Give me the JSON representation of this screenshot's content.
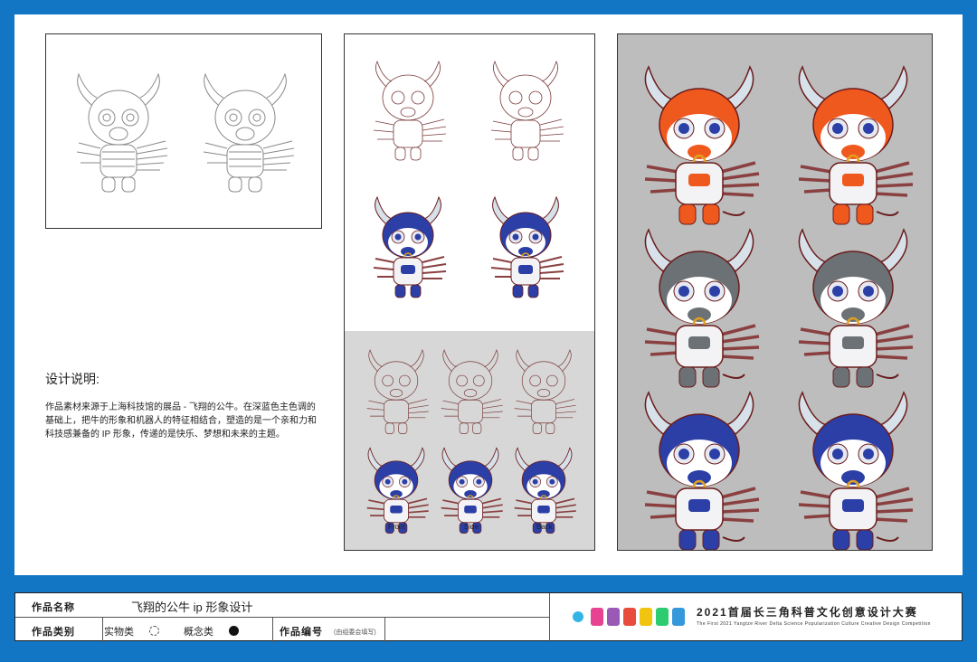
{
  "description": {
    "title": "设计说明:",
    "body": "作品素材来源于上海科技馆的展品 - 飞翔的公牛。在深蓝色主色调的基础上，把牛的形象和机器人的特征相结合，塑造的是一个亲和力和科技感兼备的 IP 形象，传递的是快乐、梦想和未来的主题。"
  },
  "views": {
    "front": "Front",
    "side": "Side",
    "back": "Back"
  },
  "footer": {
    "name_label": "作品名称",
    "name_value": "飞翔的公牛 ip 形象设计",
    "category_label": "作品类别",
    "option_physical": "实物类",
    "option_concept": "概念类",
    "number_label": "作品编号",
    "number_note": "(由组委会填写)",
    "competition_title": "2021首届长三角科普文化创意设计大赛",
    "competition_subtitle": "The First 2021 Yangtze River Delta Science Popularization Culture Creative Design Competition"
  },
  "colors": {
    "frame": "#1376c4",
    "orange": "#f0591e",
    "gray": "#6b7175",
    "blue": "#2c3fa6",
    "panel_gray": "#bdbdbd"
  }
}
